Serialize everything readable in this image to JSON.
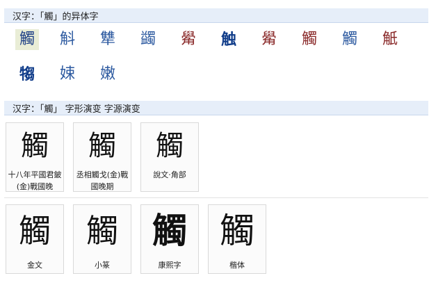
{
  "variants": {
    "title": "汉字：「觸」的异体字",
    "row1": [
      "觸",
      "斛",
      "犨",
      "蠲",
      "觷",
      "触",
      "觷",
      "觸",
      "觸",
      "觗"
    ],
    "row2": [
      "犓",
      "娕",
      "嫩"
    ]
  },
  "evolution": {
    "title": "汉字：「觸」 字形演变 字源演变",
    "cards_row1": [
      {
        "glyph": "觸",
        "caption": "十八年平國君鈹(金)戰國晚"
      },
      {
        "glyph": "觸",
        "caption": "丞相觸戈(金)戰國晚期"
      },
      {
        "glyph": "觸",
        "caption": "說文·角部"
      }
    ],
    "cards_row2": [
      {
        "glyph": "觸",
        "caption": "金文"
      },
      {
        "glyph": "觸",
        "caption": "小篆"
      },
      {
        "glyph": "觸",
        "caption": "康熙字"
      },
      {
        "glyph": "觸",
        "caption": "楷体"
      }
    ]
  }
}
